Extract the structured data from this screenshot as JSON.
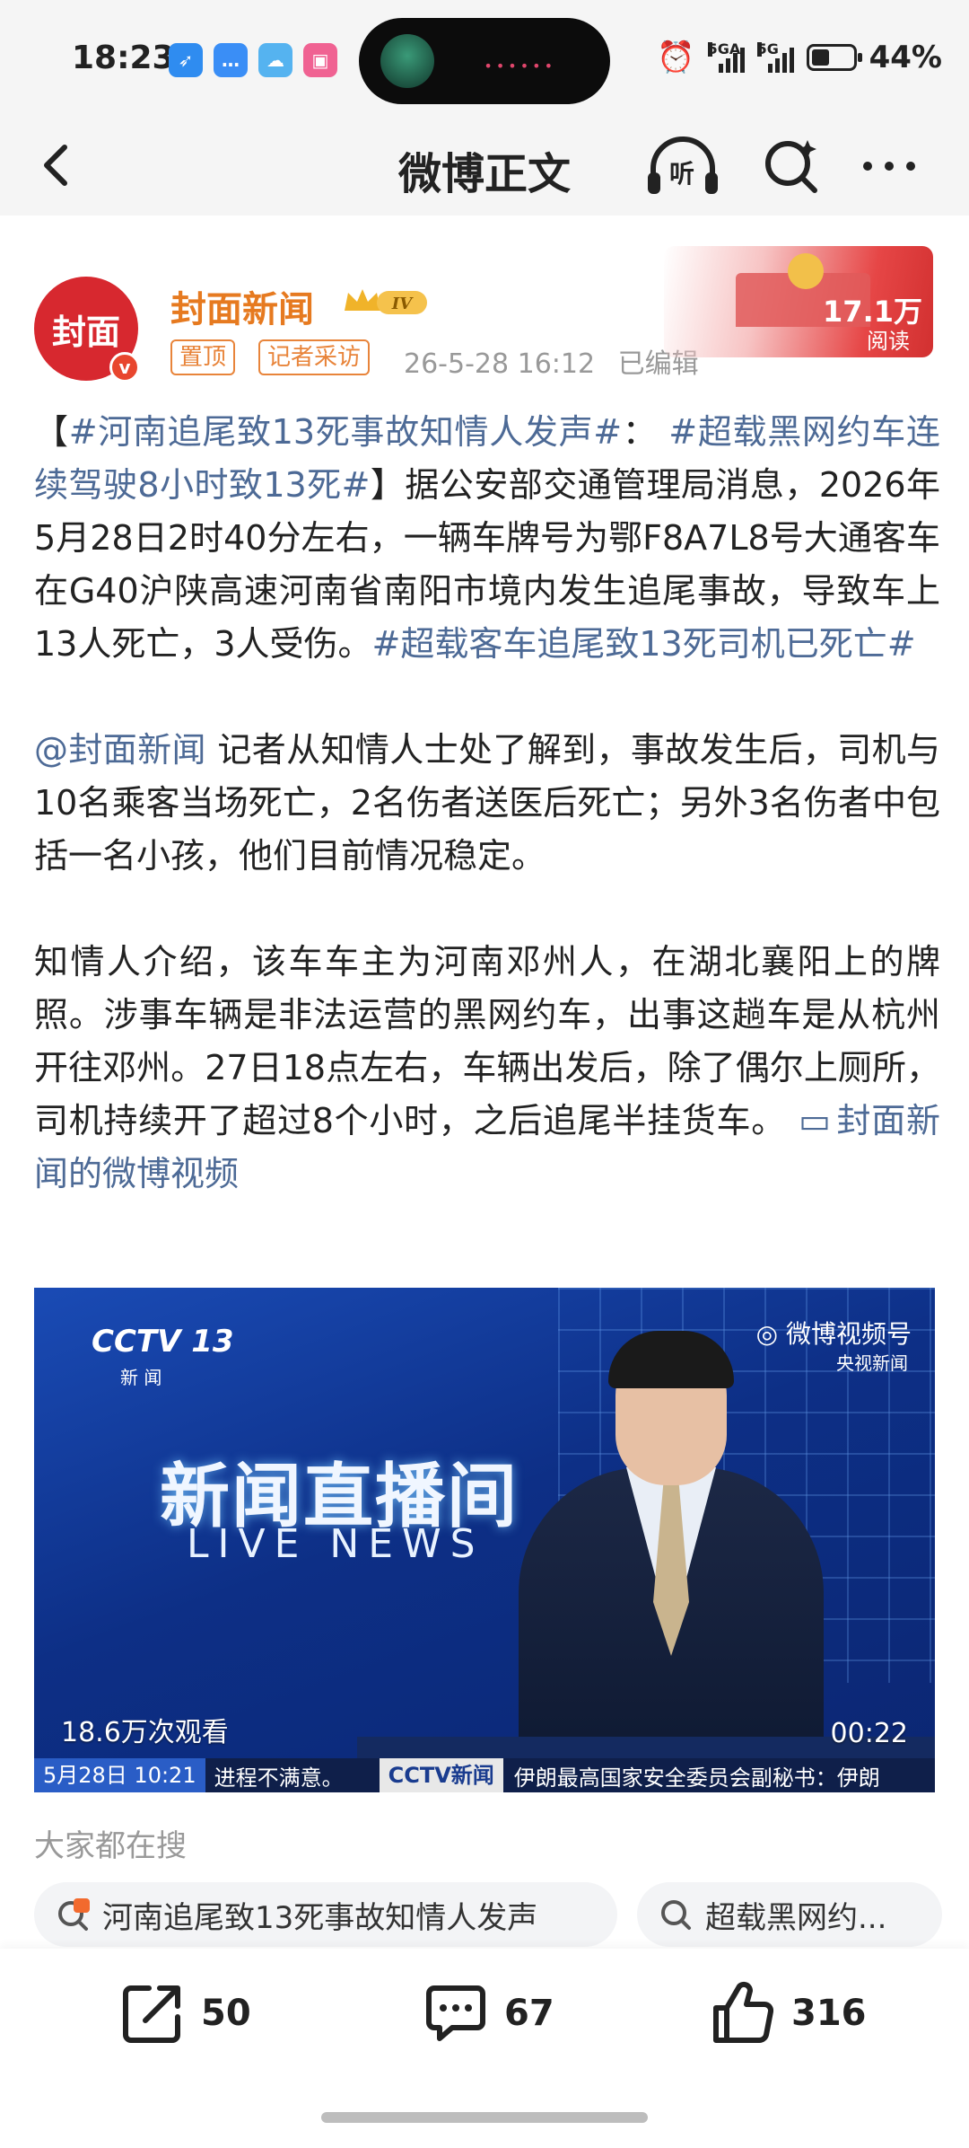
{
  "status_bar": {
    "time": "18:23",
    "app_icons": [
      "bluetooth-app-icon",
      "message-icon",
      "weather-icon",
      "bilibili-icon"
    ],
    "network_1": "5GA",
    "network_2": "5G",
    "battery_percent": "44%",
    "battery_level": 0.44
  },
  "header": {
    "title": "微博正文",
    "listen_label": "听"
  },
  "post": {
    "author": "封面新闻",
    "avatar_text": "封面",
    "level_badge": "IV",
    "tags": [
      "置顶",
      "记者采访"
    ],
    "timestamp": "26-5-28 16:12",
    "edited": "已编辑",
    "read_count": "17.1万",
    "read_label": "阅读",
    "para1": {
      "open_bracket": "【",
      "hashtag1": "#河南追尾致13死事故知情人发声#",
      "sep": "： ",
      "hashtag2": "#超载黑网约车连续驾驶8小时致13死#",
      "close_bracket": "】",
      "text": "据公安部交通管理局消息，2026年5月28日2时40分左右，一辆车牌号为鄂F8A7L8号大通客车在G40沪陕高速河南省南阳市境内发生追尾事故，导致车上13人死亡，3人受伤。",
      "hashtag3": "#超载客车追尾致13死司机已死亡#"
    },
    "para2": {
      "mention": "@封面新闻",
      "text": " 记者从知情人士处了解到，事故发生后，司机与10名乘客当场死亡，2名伤者送医后死亡；另外3名伤者中包括一名小孩，他们目前情况稳定。"
    },
    "para3": {
      "text": "知情人介绍，该车车主为河南邓州人，在湖北襄阳上的牌照。涉事车辆是非法运营的黑网约车，出事这趟车是从杭州开往邓州。27日18点左右，车辆出发后，除了偶尔上厕所，司机持续开了超过8个小时，之后追尾半挂货车。",
      "video_link": "封面新闻的微博视频"
    }
  },
  "video": {
    "channel_logo": "CCTV 13",
    "channel_sub": "新 闻",
    "weibo_logo": "微博视频号",
    "weibo_sub": "央视新闻",
    "title_cn": "新闻直播间",
    "title_en": "LIVE NEWS",
    "lower_left": "5月28日 10:21",
    "ticker": "进程不满意。",
    "lower_cctv": "CCTV新闻",
    "lower_news": "伊朗最高国家安全委员会副秘书：伊朗",
    "views": "18.6万次观看",
    "duration": "00:22"
  },
  "searching": {
    "heading": "大家都在搜",
    "chips": [
      {
        "icon": "hot-search-icon",
        "label": "河南追尾致13死事故知情人发声"
      },
      {
        "icon": "search-icon",
        "label": "超载黑网约..."
      }
    ]
  },
  "actions": {
    "share_count": "50",
    "comment_count": "67",
    "like_count": "316"
  }
}
